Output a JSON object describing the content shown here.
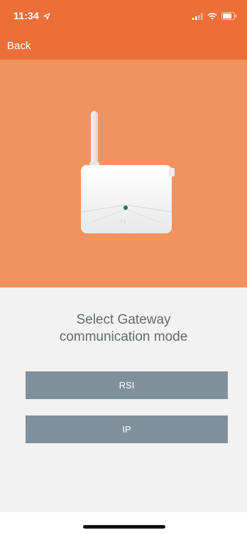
{
  "status_bar": {
    "time": "11:34",
    "location_icon": "location-arrow-icon",
    "signal_icon": "cellular-signal-icon",
    "wifi_icon": "wifi-icon",
    "battery_icon": "battery-icon"
  },
  "nav": {
    "back_label": "Back"
  },
  "hero": {
    "image": "gateway-device-image",
    "background_color": "#f1935f"
  },
  "content": {
    "prompt_line1": "Select Gateway",
    "prompt_line2": "communication mode"
  },
  "buttons": {
    "rsi_label": "RSI",
    "ip_label": "IP"
  },
  "colors": {
    "header": "#ec6f3a",
    "button": "#7f919c"
  }
}
